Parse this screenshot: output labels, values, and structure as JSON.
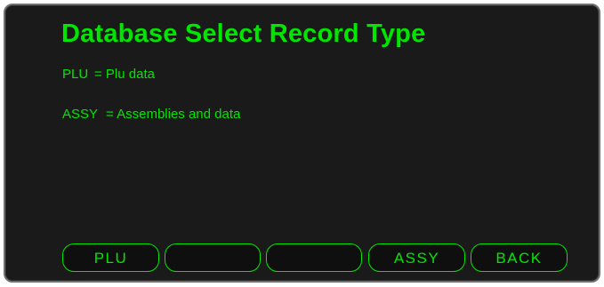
{
  "screen": {
    "title": "Database Select Record Type",
    "lines": [
      {
        "code": "PLU",
        "meaning": "= Plu data"
      },
      {
        "code": "ASSY",
        "meaning": "= Assemblies and data"
      }
    ]
  },
  "softkeys": [
    {
      "label": "PLU"
    },
    {
      "label": ""
    },
    {
      "label": ""
    },
    {
      "label": "ASSY"
    },
    {
      "label": "BACK"
    }
  ],
  "colors": {
    "text": "#00e600",
    "background": "#1a1a1a",
    "frame": "#6f6f6f"
  }
}
